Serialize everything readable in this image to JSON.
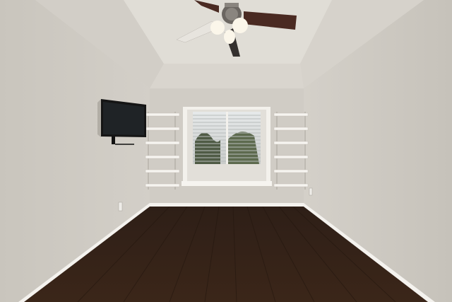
{
  "scene": {
    "type": "empty-room-photo",
    "objects": [
      "vaulted-ceiling",
      "ceiling-fan",
      "wall-mounted-tv",
      "window-with-blinds",
      "left-wall-shelves",
      "right-wall-shelves",
      "hardwood-floor",
      "baseboards",
      "wall-outlet"
    ],
    "colors": {
      "wall": "#cdc9c1",
      "wall_shadow": "#bfbab1",
      "ceiling": "#dedad3",
      "floor": "#3f2a1f",
      "trim": "#f4f2ee",
      "fan_blade": "#4a2a22",
      "tv": "#151515"
    }
  }
}
